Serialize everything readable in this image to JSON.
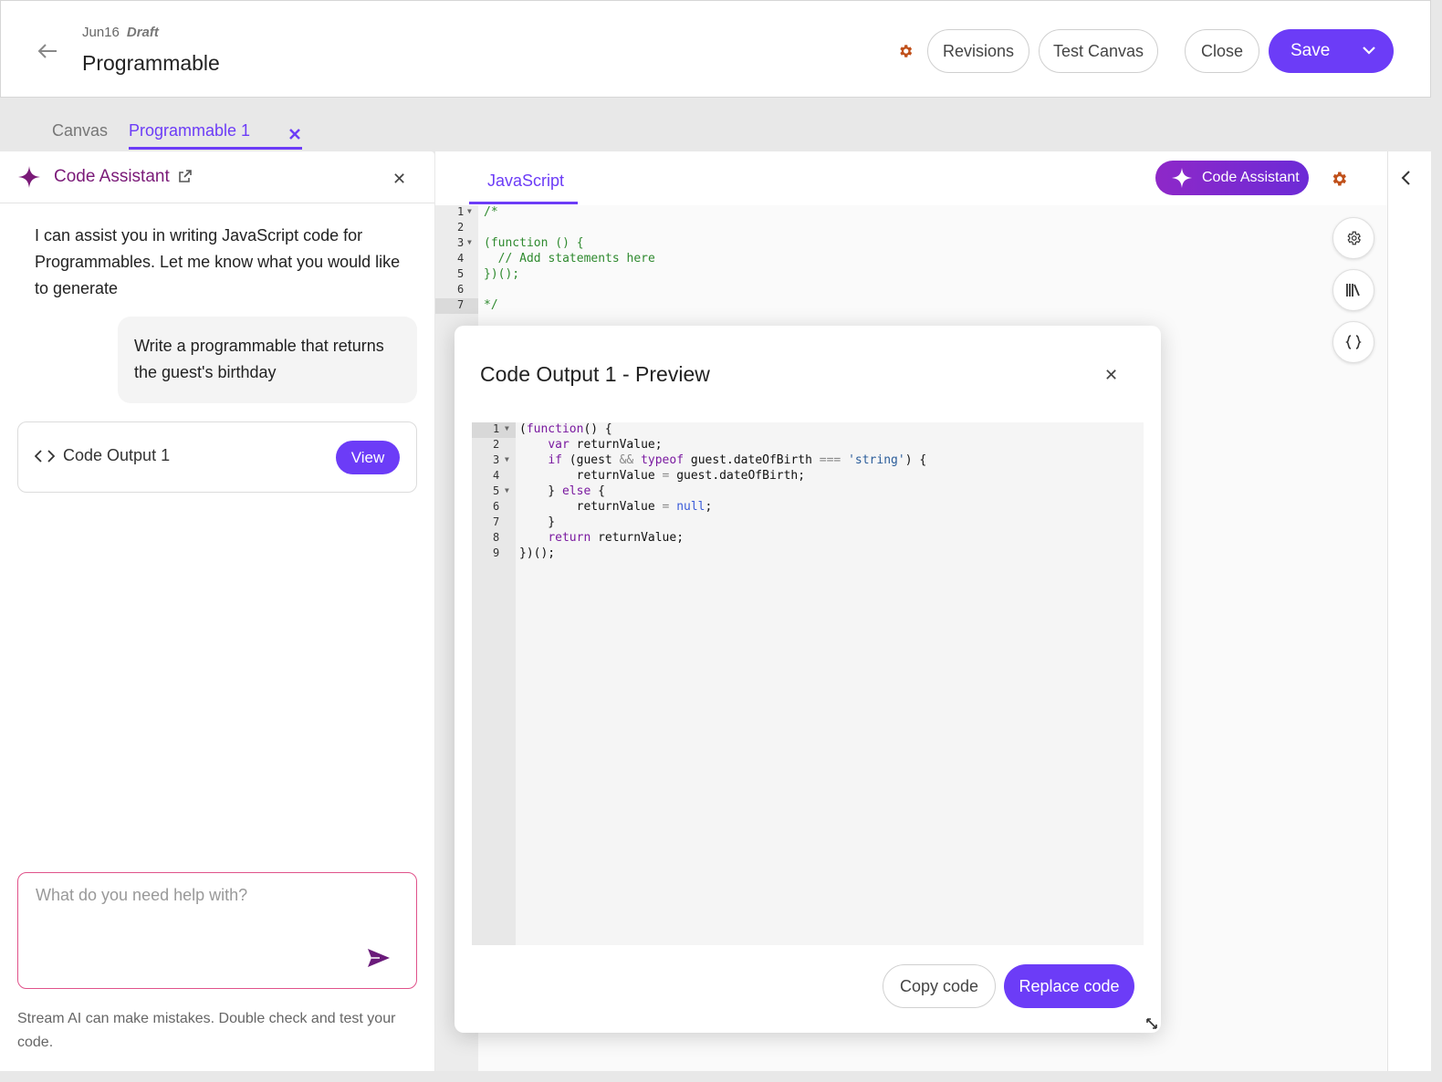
{
  "header": {
    "date": "Jun16",
    "status": "Draft",
    "title": "Programmable",
    "revisions_label": "Revisions",
    "test_canvas_label": "Test Canvas",
    "close_label": "Close",
    "save_label": "Save"
  },
  "tabs": [
    {
      "label": "Canvas",
      "active": false
    },
    {
      "label": "Programmable 1",
      "active": true
    }
  ],
  "assistant_panel": {
    "title": "Code Assistant",
    "assistant_message": "I can assist you in writing JavaScript code for Programmables. Let me know what you would like to generate",
    "user_message": "Write a programmable that returns the guest's birthday",
    "output_card": {
      "label": "Code Output 1",
      "view_label": "View"
    },
    "prompt_placeholder": "What do you need help with?",
    "disclaimer": "Stream AI can make mistakes. Double check and test your code."
  },
  "editor": {
    "tab_label": "JavaScript",
    "assistant_button_label": "Code Assistant",
    "lines": [
      "/*",
      "",
      "(function () {",
      "  // Add statements here",
      "})();",
      "",
      "*/"
    ],
    "folded_lines": [
      1,
      3
    ],
    "active_line": 7
  },
  "modal": {
    "title": "Code Output 1 - Preview",
    "copy_label": "Copy code",
    "replace_label": "Replace code",
    "line_numbers": [
      "1",
      "2",
      "3",
      "4",
      "5",
      "6",
      "7",
      "8",
      "9"
    ],
    "folded_lines": [
      1,
      3,
      5
    ],
    "active_line": 1
  },
  "colors": {
    "accent": "#6c3cf7",
    "assistant_title": "#7a1a78",
    "settings_icon": "#c0501a",
    "prompt_border": "#e0528a"
  }
}
